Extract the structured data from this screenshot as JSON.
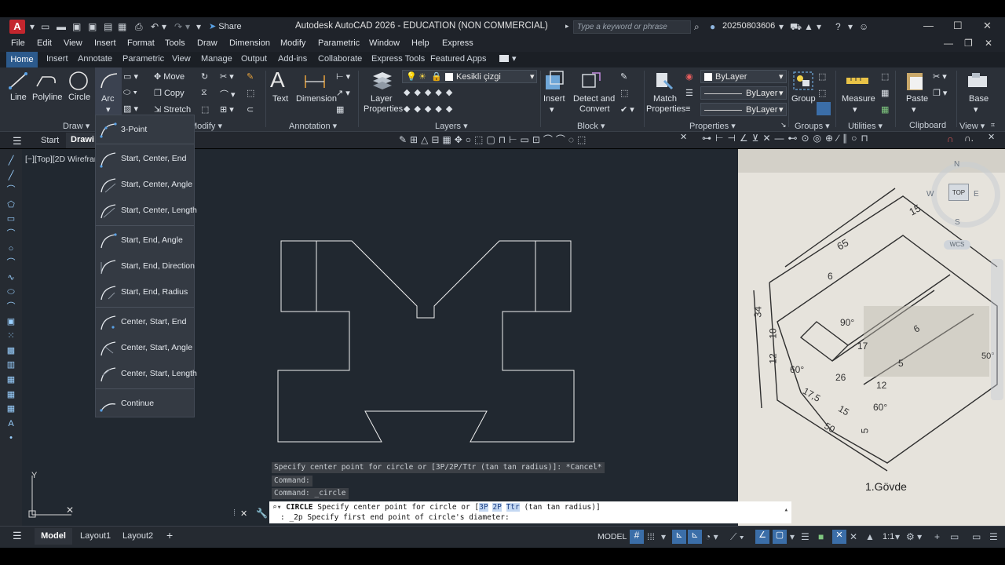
{
  "app": {
    "title": "Autodesk AutoCAD 2026 - EDUCATION (NON COMMERCIAL)",
    "logo": "A",
    "share_label": "Share",
    "search_placeholder": "Type a keyword or phrase",
    "user_id": "20250803606"
  },
  "menubar": [
    "File",
    "Edit",
    "View",
    "Insert",
    "Format",
    "Tools",
    "Draw",
    "Dimension",
    "Modify",
    "Parametric",
    "Window",
    "Help",
    "Express"
  ],
  "ribbon_tabs": [
    "Home",
    "Insert",
    "Annotate",
    "Parametric",
    "View",
    "Manage",
    "Output",
    "Add-ins",
    "Collaborate",
    "Express Tools",
    "Featured Apps"
  ],
  "ribbon": {
    "draw": {
      "line": "Line",
      "polyline": "Polyline",
      "circle": "Circle",
      "arc": "Arc",
      "title": "Draw"
    },
    "modify": {
      "move": "Move",
      "copy": "Copy",
      "stretch": "Stretch",
      "title": "Modify"
    },
    "annotation": {
      "text": "Text",
      "dimension": "Dimension",
      "title": "Annotation"
    },
    "layers": {
      "layer_properties_1": "Layer",
      "layer_properties_2": "Properties",
      "current_layer": "Kesikli çizgi",
      "title": "Layers"
    },
    "block": {
      "insert": "Insert",
      "detect_1": "Detect and",
      "detect_2": "Convert",
      "title": "Block"
    },
    "properties": {
      "match_1": "Match",
      "match_2": "Properties",
      "bylayer_color": "ByLayer",
      "bylayer_line": "ByLayer",
      "bylayer_weight": "ByLayer",
      "title": "Properties"
    },
    "groups": {
      "group": "Group",
      "title": "Groups"
    },
    "utilities": {
      "measure": "Measure",
      "title": "Utilities"
    },
    "clipboard": {
      "paste": "Paste",
      "title": "Clipboard"
    },
    "view": {
      "base": "Base",
      "title": "View"
    }
  },
  "file_tabs": {
    "start": "Start",
    "drawing": "Drawi"
  },
  "viewport_label": "[−][Top][2D Wirefran",
  "arc_menu": [
    "3-Point",
    "Start, Center, End",
    "Start, Center, Angle",
    "Start, Center, Length",
    "Start, End, Angle",
    "Start, End, Direction",
    "Start, End, Radius",
    "Center, Start, End",
    "Center, Start, Angle",
    "Center, Start, Length",
    "Continue"
  ],
  "command_history": [
    "Specify center point for circle or [3P/2P/Ttr (tan tan radius)]: *Cancel*",
    "Command:",
    "Command: _circle"
  ],
  "command_prompt": {
    "command": "CIRCLE",
    "prefix": "Specify center point for circle or [",
    "opt1": "3P",
    "opt2": "2P",
    "opt3": "Ttr",
    "suffix": "(tan tan radius)]",
    "line2": ": _2p Specify first end point of circle's diameter:"
  },
  "viewcube": {
    "top": "TOP",
    "n": "N",
    "s": "S",
    "e": "E",
    "w": "W",
    "wcs": "WCS"
  },
  "axis": {
    "y": "Y"
  },
  "photo_labels": {
    "caption": "1.Gövde",
    "dims": [
      "15",
      "65",
      "6",
      "34",
      "10",
      "12",
      "90°",
      "6",
      "17",
      "60°",
      "17,5",
      "26",
      "15",
      "50",
      "5",
      "12",
      "60°",
      "5",
      "50°"
    ]
  },
  "layout_tabs": {
    "model": "Model",
    "layout1": "Layout1",
    "layout2": "Layout2",
    "add": "+"
  },
  "status": {
    "model": "MODEL",
    "scale": "1:1"
  }
}
